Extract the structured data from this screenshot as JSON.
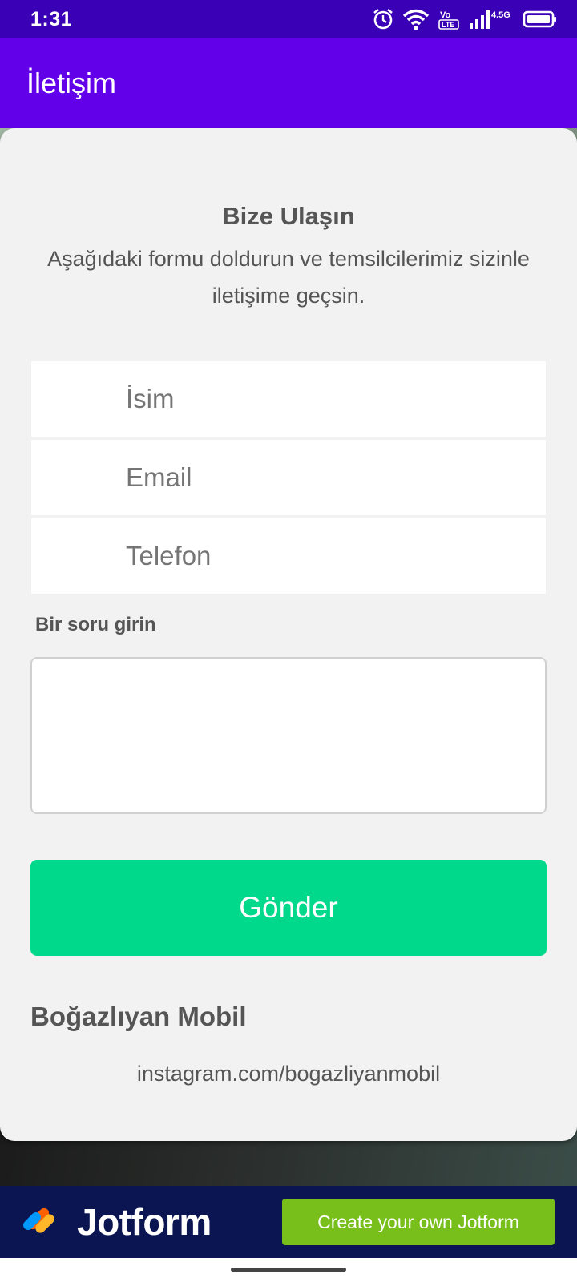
{
  "status_bar": {
    "time": "1:31",
    "icons": [
      "alarm-icon",
      "wifi-icon",
      "volte-icon",
      "signal-icon",
      "battery-icon"
    ],
    "network_label": "4.5G"
  },
  "app_bar": {
    "title": "İletişim"
  },
  "form": {
    "title": "Bize Ulaşın",
    "subtitle": "Aşağıdaki formu doldurun ve temsilcilerimiz sizinle iletişime geçsin.",
    "fields": {
      "name_placeholder": "İsim",
      "email_placeholder": "Email",
      "phone_placeholder": "Telefon"
    },
    "question_label": "Bir soru girin",
    "submit_label": "Gönder",
    "company_name": "Boğazlıyan Mobil",
    "company_link": "instagram.com/bogazliyanmobil"
  },
  "jotform": {
    "brand": "Jotform",
    "cta_label": "Create your own Jotform"
  },
  "colors": {
    "status_bar": "#3a00b5",
    "app_bar": "#6200ea",
    "submit": "#00d98b",
    "jotform_bar": "#0b1551",
    "jotform_cta": "#78bf1c"
  }
}
